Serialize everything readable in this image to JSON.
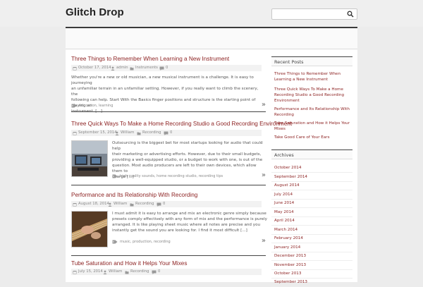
{
  "site": {
    "title": "Glitch Drop"
  },
  "search": {
    "placeholder": "",
    "value": ""
  },
  "posts": [
    {
      "title": "Three Things to Remember When Learning a New Instrument",
      "date": "October 17, 2014",
      "author": "admin",
      "category": "Instruments",
      "comments": "0",
      "excerpt": [
        "Whether you're a new or old musician, a new musical instrument is a challenge. It is easy to journeying",
        "an unfamiliar terrain in an unfamiliar setting. However, if you really want to climb the scenery, the",
        "following can help. Start With the Basics finger positions and structure is the starting point of playing an",
        "instrument. [...]"
      ],
      "tags": "education, learning"
    },
    {
      "title": "Three Quick Ways To Make a Home Recording Studio a Good Recording Environment",
      "date": "September 15, 2014",
      "author": "William",
      "category": "Recording",
      "comments": "0",
      "excerpt": [
        "Outsourcing is the biggest bet for most startups looking for audio that could help",
        "their marketing or advertising efforts. However, due to their small budgets,",
        "providing a well-equipped studio, or a budget to work with one, is out of the",
        "question. Most audio producers are left to their own devices, which allow them to",
        "charge [...]"
      ],
      "tags": "high quality sounds, home recording studio, recording tips"
    },
    {
      "title": "Performance and Its Relationship With Recording",
      "date": "August 18, 2014",
      "author": "William",
      "category": "Recording",
      "comments": "0",
      "excerpt": [
        "I must admit it is easy to arrange and mix an electronic genre simply because",
        "presets comply effectively with any form of mix and the performance is purely",
        "arranged. It is like playing sheet music where all notes are precise and you",
        "instantly get the sound you are looking for. I find it most difficult [...]"
      ],
      "tags": "music, production, recording"
    },
    {
      "title": "Tube Saturation and How it Helps Your Mixes",
      "date": "July 15, 2014",
      "author": "William",
      "category": "Recording",
      "comments": "0"
    }
  ],
  "sidebar": {
    "recent_title": "Recent Posts",
    "recent": [
      [
        "Three Things to Remember When",
        "Learning a New Instrument"
      ],
      [
        "Three Quick Ways To Make a Home",
        "Recording Studio a Good Recording",
        "Environment"
      ],
      [
        "Performance and Its Relationship With",
        "Recording"
      ],
      [
        "Tube Saturation and How it Helps Your",
        "Mixes"
      ],
      [
        "Take Good Care of Your Ears"
      ]
    ],
    "archives_title": "Archives",
    "archives": [
      "October 2014",
      "September 2014",
      "August 2014",
      "July 2014",
      "June 2014",
      "May 2014",
      "April 2014",
      "March 2014",
      "February 2014",
      "January 2014",
      "December 2013",
      "November 2013",
      "October 2013",
      "September 2013"
    ]
  },
  "colors": {
    "link": "#8b1f1f",
    "rule": "#3a3a3a",
    "background": "#ececec"
  },
  "icons": {
    "search": "magnifier-icon",
    "date": "calendar-icon",
    "author": "user-icon",
    "category": "folder-icon",
    "comments": "speech-bubble-icon",
    "tags": "tag-icon",
    "more": "double-chevron-right-icon"
  }
}
